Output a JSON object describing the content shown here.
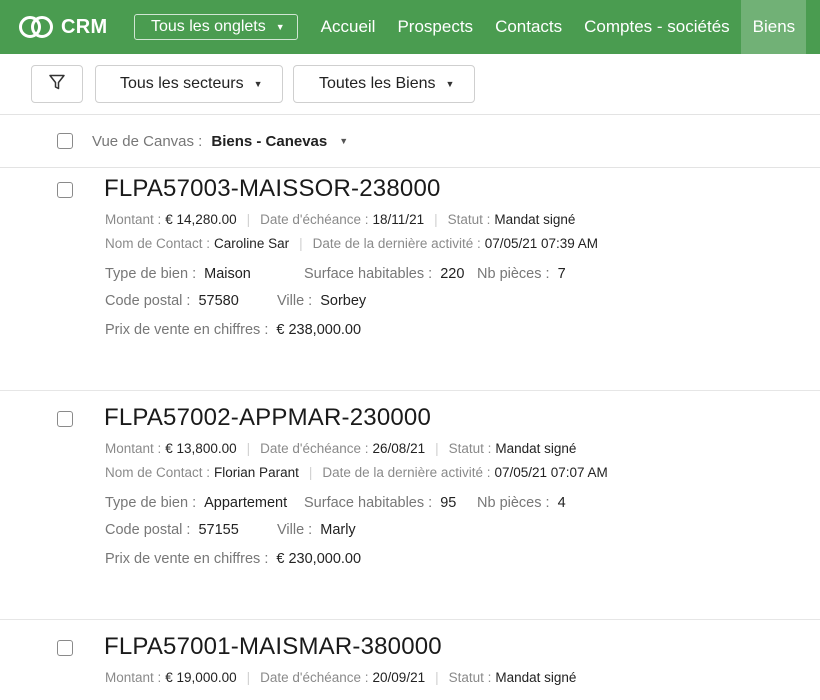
{
  "app": {
    "name": "CRM"
  },
  "topnav": {
    "tabs_selector": "Tous les onglets",
    "items": [
      {
        "label": "Accueil"
      },
      {
        "label": "Prospects"
      },
      {
        "label": "Contacts"
      },
      {
        "label": "Comptes - sociétés"
      },
      {
        "label": "Biens",
        "active": true
      }
    ]
  },
  "filters": {
    "sectors": "Tous les secteurs",
    "biens": "Toutes les Biens"
  },
  "view": {
    "label": "Vue de Canvas :",
    "value": "Biens - Canevas"
  },
  "labels": {
    "montant": "Montant :",
    "echeance": "Date d'échéance :",
    "statut": "Statut :",
    "contact": "Nom de Contact :",
    "derniere_activite": "Date de la dernière activité :",
    "type": "Type de bien :",
    "surface": "Surface habitables :",
    "pieces": "Nb pièces :",
    "code_postal": "Code postal :",
    "ville": "Ville :",
    "prix": "Prix de vente en chiffres :"
  },
  "records": [
    {
      "title": "FLPA57003-MAISSOR-238000",
      "montant": "€ 14,280.00",
      "echeance": "18/11/21",
      "statut": "Mandat signé",
      "contact": "Caroline Sar",
      "derniere_activite": "07/05/21 07:39 AM",
      "type": "Maison",
      "surface": "220",
      "pieces": "7",
      "code_postal": "57580",
      "ville": "Sorbey",
      "prix": "€ 238,000.00"
    },
    {
      "title": "FLPA57002-APPMAR-230000",
      "montant": "€ 13,800.00",
      "echeance": "26/08/21",
      "statut": "Mandat signé",
      "contact": "Florian Parant",
      "derniere_activite": "07/05/21 07:07 AM",
      "type": "Appartement",
      "surface": "95",
      "pieces": "4",
      "code_postal": "57155",
      "ville": "Marly",
      "prix": "€ 230,000.00"
    },
    {
      "title": "FLPA57001-MAISMAR-380000",
      "montant": "€ 19,000.00",
      "echeance": "20/09/21",
      "statut": "Mandat signé"
    }
  ]
}
